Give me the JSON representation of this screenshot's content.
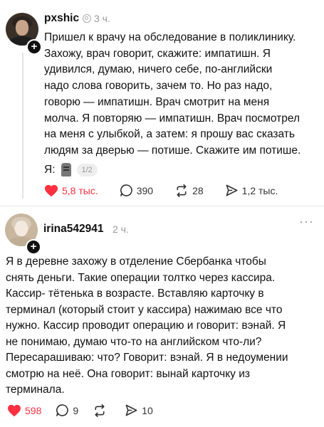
{
  "posts": [
    {
      "username": "pxshic",
      "time": "3 ч.",
      "text": "Пришел к врачу на обследование в поликлинику.\nЗахожу, врач говорит, скажите: импатишн. Я\nудивился, думаю, ничего себе, по-английски\nнадо слова говорить, зачем то. Но раз надо,\nговорю — импатишн. Врач смотрит на меня\nмолча. Я повторяю — импатишн. Врач посмотрел\nна меня с улыбкой, а затем: я прошу вас сказать\nлюдям за дверью — потише. Скажите им потише.",
      "attachment_label": "Я:",
      "pager": "1/2",
      "likes": "5,8 тыс.",
      "replies": "390",
      "reposts": "28",
      "shares": "1,2 тыс."
    },
    {
      "username": "irina542941",
      "time": "2 ч.",
      "text": "Я в деревне захожу в отделение Сбербанка чтобы\nснять деньги. Такие операции толтко через кассира.\nКассир- тётенька в возрасте.  Вставляю карточку в\nтерминал (который стоит у кассира) нажимаю все что\nнужно. Кассир проводит операцию и говорит: вэнай.  Я\nне понимаю, думаю что-то на английском что-ли?\nПересарашиваю: что? Говорит: вэнай. Я в недоумении\nсмотрю на неё. Она говорит: вынай карточку из\nтерминала.",
      "likes": "598",
      "replies": "9",
      "reposts": "",
      "shares": "10"
    }
  ],
  "ui": {
    "follow_symbol": "+",
    "more_symbol": "···",
    "like_color": "#ff3040"
  }
}
